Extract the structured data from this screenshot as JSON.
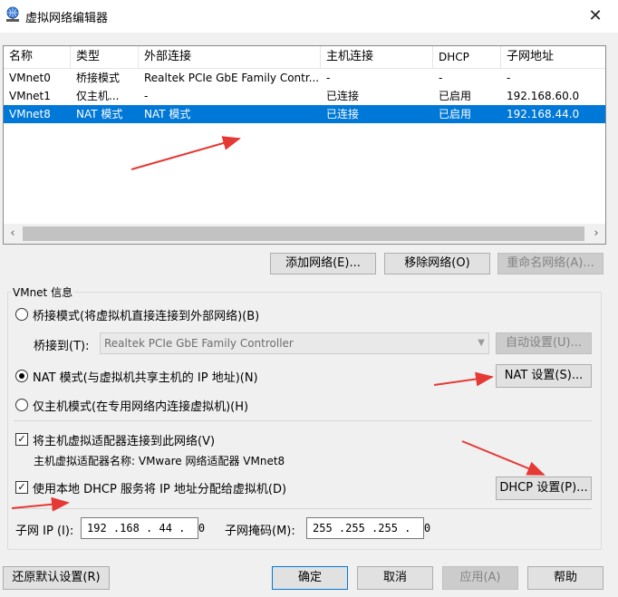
{
  "window": {
    "title": "虚拟网络编辑器",
    "close_symbol": "✕",
    "icon": "network-globe-icon"
  },
  "table": {
    "columns": [
      "名称",
      "类型",
      "外部连接",
      "主机连接",
      "DHCP",
      "子网地址"
    ],
    "rows": [
      {
        "name": "VMnet0",
        "type": "桥接模式",
        "external": "Realtek PCIe GbE Family Contr...",
        "host": "-",
        "dhcp": "-",
        "subnet": "-"
      },
      {
        "name": "VMnet1",
        "type": "仅主机...",
        "external": "-",
        "host": "已连接",
        "dhcp": "已启用",
        "subnet": "192.168.60.0"
      },
      {
        "name": "VMnet8",
        "type": "NAT 模式",
        "external": "NAT 模式",
        "host": "已连接",
        "dhcp": "已启用",
        "subnet": "192.168.44.0",
        "selected": true
      }
    ],
    "scroll_left_symbol": "‹",
    "scroll_right_symbol": "›"
  },
  "network_buttons": {
    "add": "添加网络(E)...",
    "remove": "移除网络(O)",
    "rename": "重命名网络(A)..."
  },
  "vmnet_info": {
    "group_label": "VMnet 信息",
    "bridged_mode": "桥接模式(将虚拟机直接连接到外部网络)(B)",
    "bridged_to_label": "桥接到(T):",
    "bridged_to_value": "Realtek PCIe GbE Family Controller",
    "auto_settings": "自动设置(U)...",
    "nat_mode": "NAT 模式(与虚拟机共享主机的 IP 地址)(N)",
    "nat_settings": "NAT 设置(S)...",
    "host_only_mode": "仅主机模式(在专用网络内连接虚拟机)(H)",
    "selected_mode": "nat",
    "connect_host_adapter": "将主机虚拟适配器连接到此网络(V)",
    "host_adapter_name": "主机虚拟适配器名称: VMware 网络适配器 VMnet8",
    "use_local_dhcp": "使用本地 DHCP 服务将 IP 地址分配给虚拟机(D)",
    "dhcp_settings": "DHCP 设置(P)...",
    "subnet_ip_label": "子网 IP (I):",
    "subnet_ip_value": "192 .168 . 44 .  0",
    "subnet_mask_label": "子网掩码(M):",
    "subnet_mask_value": "255 .255 .255 .  0",
    "checkmark": "✓"
  },
  "footer": {
    "restore_defaults": "还原默认设置(R)",
    "ok": "确定",
    "cancel": "取消",
    "apply": "应用(A)",
    "help": "帮助"
  },
  "colors": {
    "selection": "#0078d7",
    "annotation_arrow": "#e53935",
    "primary_border": "#0078d7"
  }
}
